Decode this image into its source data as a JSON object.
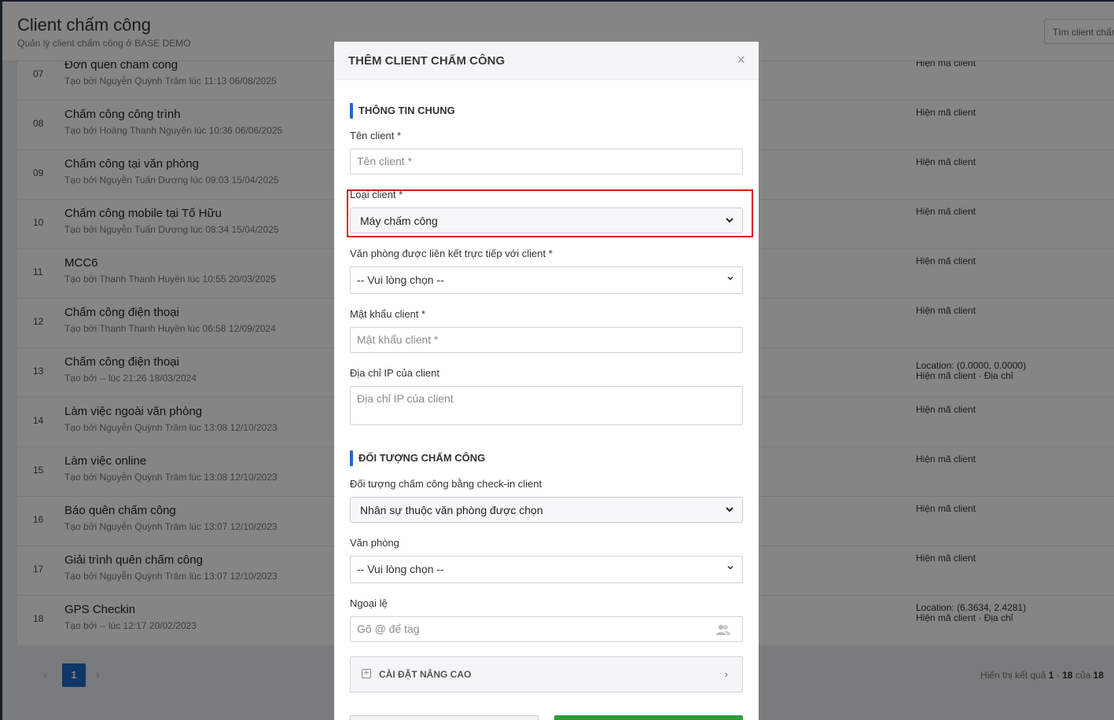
{
  "page": {
    "title": "Client chấm công",
    "subtitle": "Quản lý client chấm công ở BASE DEMO",
    "search_label": "Tìm client chấm"
  },
  "rows": [
    {
      "num": "07",
      "title": "Đơn quên chấm công",
      "meta": "Tạo bởi Nguyễn Quỳnh Trâm lúc 11:13 06/08/2025",
      "right1": "Hiện mã client",
      "right2": ""
    },
    {
      "num": "08",
      "title": "Chấm công công trình",
      "meta": "Tạo bởi Hoàng Thanh Nguyên lúc 10:36 06/06/2025",
      "right1": "Hiện mã client",
      "right2": ""
    },
    {
      "num": "09",
      "title": "Chấm công tại văn phòng",
      "meta": "Tạo bởi Nguyễn Tuấn Dương lúc 09:03 15/04/2025",
      "right1": "Hiện mã client",
      "right2": ""
    },
    {
      "num": "10",
      "title": "Chấm công mobile tại Tố Hữu",
      "meta": "Tạo bởi Nguyễn Tuấn Dương lúc 08:34 15/04/2025",
      "right1": "Hiện mã client",
      "right2": ""
    },
    {
      "num": "11",
      "title": "MCC6",
      "meta": "Tạo bởi Thanh Thanh Huyền lúc 10:55 20/03/2025",
      "right1": "Hiện mã client",
      "right2": ""
    },
    {
      "num": "12",
      "title": "Chấm công điện thoại",
      "meta": "Tạo bởi Thanh Thanh Huyền lúc 06:58 12/09/2024",
      "right1": "Hiện mã client",
      "right2": ""
    },
    {
      "num": "13",
      "title": "Chấm công điện thoại",
      "meta": "Tạo bởi -- lúc 21:26 18/03/2024",
      "right1": "Location: (0.0000, 0.0000)",
      "right2": "Hiện mã client · Địa chỉ"
    },
    {
      "num": "14",
      "title": "Làm việc ngoài văn phòng",
      "meta": "Tạo bởi Nguyễn Quỳnh Trâm lúc 13:08 12/10/2023",
      "right1": "Hiện mã client",
      "right2": ""
    },
    {
      "num": "15",
      "title": "Làm việc online",
      "meta": "Tạo bởi Nguyễn Quỳnh Trâm lúc 13:08 12/10/2023",
      "right1": "Hiện mã client",
      "right2": ""
    },
    {
      "num": "16",
      "title": "Báo quên chấm công",
      "meta": "Tạo bởi Nguyễn Quỳnh Trâm lúc 13:07 12/10/2023",
      "right1": "Hiện mã client",
      "right2": ""
    },
    {
      "num": "17",
      "title": "Giải trình quên chấm công",
      "meta": "Tạo bởi Nguyễn Quỳnh Trâm lúc 13:07 12/10/2023",
      "right1": "Hiện mã client",
      "right2": ""
    },
    {
      "num": "18",
      "title": "GPS Checkin",
      "meta": "Tạo bởi -- lúc 12:17 20/02/2023",
      "right1": "Location: (6.3634, 2.4281)",
      "right2": "Hiện mã client · Địa chỉ"
    }
  ],
  "pager": {
    "prev": "‹",
    "current": "1",
    "next": "›",
    "info_prefix": "Hiển thị kết quả",
    "info_range_start": "1",
    "info_dash": "-",
    "info_range_end": "18",
    "info_of": "của",
    "info_total": "18"
  },
  "modal": {
    "title": "THÊM CLIENT CHẤM CÔNG",
    "close": "×",
    "section_general": "THÔNG TIN CHUNG",
    "client_name_label": "Tên client *",
    "client_name_placeholder": "Tên client *",
    "client_type_label": "Loại client *",
    "client_type_value": "Máy chấm công",
    "office_link_label": "Văn phòng được liên kết trực tiếp với client *",
    "office_link_value": "-- Vui lòng chọn --",
    "password_label": "Mật khẩu client *",
    "password_placeholder": "Mật khẩu client *",
    "ip_label": "Địa chỉ IP của client",
    "ip_placeholder": "Địa chỉ IP của client",
    "section_target": "ĐỐI TƯỢNG CHẤM CÔNG",
    "target_label": "Đối tượng chấm công bằng check-in client",
    "target_value": "Nhân sự thuộc văn phòng được chọn",
    "office_label": "Văn phòng",
    "office_value": "-- Vui lòng chọn --",
    "exception_label": "Ngoại lệ",
    "exception_placeholder": "Gõ @ để tag",
    "advanced_label": "CÀI ĐẶT NÂNG CAO"
  },
  "colors": {
    "primary": "#1e6ac6",
    "highlight": "#e0141b",
    "save": "#2e9b3a"
  },
  "icons": {
    "close": "close-icon",
    "chevron": "chevron-down-icon",
    "users": "users-icon",
    "plus": "plus-square-icon",
    "arrow": "chevron-right-icon"
  }
}
